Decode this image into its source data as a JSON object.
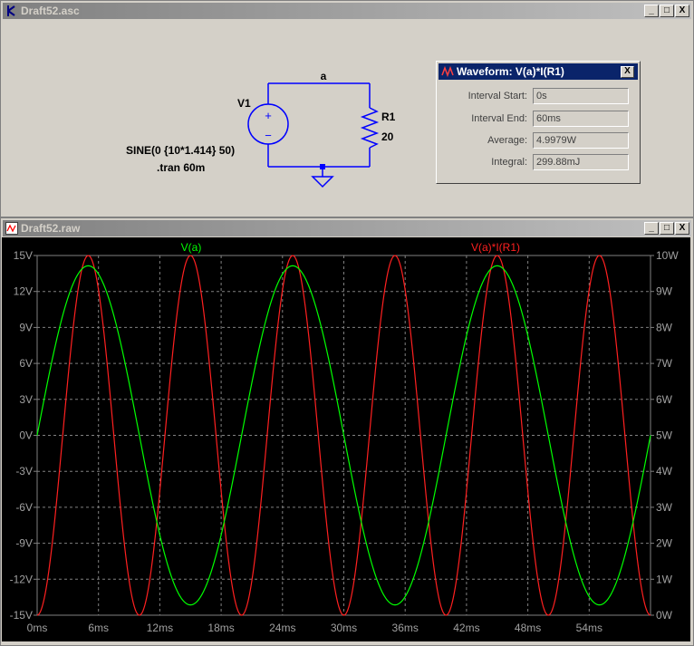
{
  "schematic_window": {
    "title": "Draft52.asc",
    "buttons": {
      "minimize": "_",
      "maximize": "□",
      "close": "X"
    },
    "net_label": "a",
    "source_name": "V1",
    "source_plus": "+",
    "source_minus": "−",
    "source_value": "SINE(0 {10*1.414} 50)",
    "directive": ".tran 60m",
    "resistor_name": "R1",
    "resistor_value": "20"
  },
  "waveform_dialog": {
    "title": "Waveform: V(a)*I(R1)",
    "close": "X",
    "fields": [
      {
        "label": "Interval Start:",
        "value": "0s"
      },
      {
        "label": "Interval End:",
        "value": "60ms"
      },
      {
        "label": "Average:",
        "value": "4.9979W"
      },
      {
        "label": "Integral:",
        "value": "299.88mJ"
      }
    ]
  },
  "plot_window": {
    "title": "Draft52.raw",
    "buttons": {
      "minimize": "_",
      "maximize": "□",
      "close": "X"
    }
  },
  "colors": {
    "grid": "#808080",
    "axis_text": "#a0a0a0",
    "va": "#00ff00",
    "power": "#ff2020",
    "background": "#000000"
  },
  "chart_data": {
    "type": "line",
    "xlabel": "",
    "xlim": [
      0,
      60
    ],
    "x_unit": "ms",
    "x_ticks": [
      "0ms",
      "6ms",
      "12ms",
      "18ms",
      "24ms",
      "30ms",
      "36ms",
      "42ms",
      "48ms",
      "54ms"
    ],
    "x_tick_values": [
      0,
      6,
      12,
      18,
      24,
      30,
      36,
      42,
      48,
      54
    ],
    "ylim_left": [
      -15,
      15
    ],
    "ylim_right": [
      0,
      10
    ],
    "y_ticks_left": [
      "15V",
      "12V",
      "9V",
      "6V",
      "3V",
      "0V",
      "-3V",
      "-6V",
      "-9V",
      "-12V",
      "-15V"
    ],
    "y_ticks_right": [
      "10W",
      "9W",
      "8W",
      "7W",
      "6W",
      "5W",
      "4W",
      "3W",
      "2W",
      "1W",
      "0W"
    ],
    "grid": true,
    "series": [
      {
        "name": "V(a)",
        "axis": "left",
        "function": "14.14*sin(2*pi*50*t)",
        "amplitude": 14.14,
        "frequency_hz": 50,
        "offset": 0
      },
      {
        "name": "V(a)*I(R1)",
        "axis": "right",
        "function": "9.998*sin^2(2*pi*50*t)",
        "peak": 9.998,
        "frequency_hz": 50,
        "offset": 0
      }
    ]
  }
}
